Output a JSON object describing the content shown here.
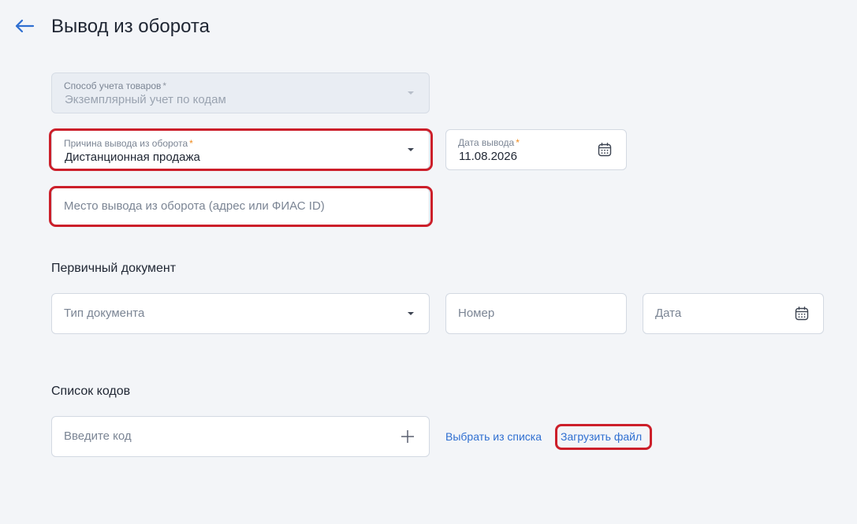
{
  "page": {
    "title": "Вывод из оборота",
    "back_icon": "arrow-left-icon"
  },
  "form": {
    "accounting_method": {
      "label": "Способ учета товаров",
      "required_mark": "*",
      "value": "Экземплярный учет по кодам",
      "disabled": true
    },
    "withdrawal_reason": {
      "label": "Причина вывода из оборота",
      "required_mark": "*",
      "value": "Дистанционная продажа"
    },
    "withdrawal_date": {
      "label": "Дата вывода",
      "required_mark": "*",
      "value": "11.08.2026"
    },
    "withdrawal_place": {
      "placeholder": "Место вывода из оборота (адрес или ФИАС ID)"
    }
  },
  "primary_document": {
    "title": "Первичный документ",
    "doc_type_placeholder": "Тип документа",
    "number_placeholder": "Номер",
    "date_placeholder": "Дата"
  },
  "codes": {
    "title": "Список кодов",
    "code_placeholder": "Введите код",
    "select_from_list": "Выбрать из списка",
    "upload_file": "Загрузить файл"
  },
  "colors": {
    "accent": "#2f6fd1",
    "required": "#f08a1c",
    "highlight": "#cc1f2a",
    "background": "#f3f5f8"
  }
}
